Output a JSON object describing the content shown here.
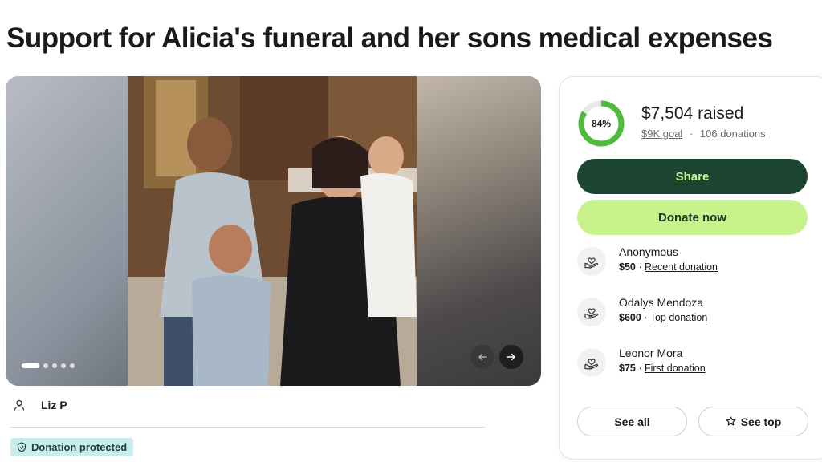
{
  "campaign": {
    "title": "Support for Alicia's funeral and her sons medical expenses"
  },
  "gallery": {
    "photo_count": 5,
    "active_index": 0,
    "prev_icon": "arrow-left-icon",
    "next_icon": "arrow-right-icon"
  },
  "organizer": {
    "name": "Liz P",
    "icon": "user-icon"
  },
  "badge": {
    "label": "Donation protected",
    "icon": "shield-icon"
  },
  "progress": {
    "percent_label": "84%",
    "fraction": 0.84,
    "raised": "$7,504 raised",
    "goal": "$9K goal",
    "separator": "·",
    "donations": "106 donations"
  },
  "actions": {
    "share": "Share",
    "donate": "Donate now",
    "see_all": "See all",
    "see_top": "See top"
  },
  "donations": [
    {
      "name": "Anonymous",
      "amount": "$50",
      "sep": " · ",
      "type": "Recent donation"
    },
    {
      "name": "Odalys Mendoza",
      "amount": "$600",
      "sep": " · ",
      "type": "Top donation"
    },
    {
      "name": "Leonor Mora",
      "amount": "$75",
      "sep": " · ",
      "type": "First donation"
    }
  ],
  "colors": {
    "share_bg": "#1c4632",
    "donate_bg": "#c8f28c",
    "progress": "#4fba3e",
    "badge_bg": "#c9ecec"
  }
}
